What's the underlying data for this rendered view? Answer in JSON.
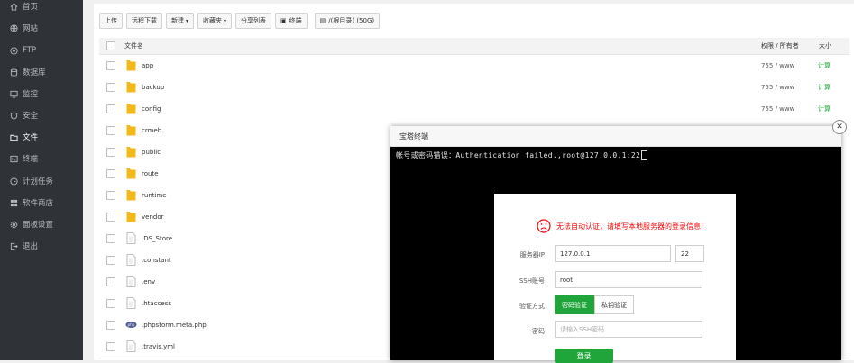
{
  "sidebar": {
    "items": [
      {
        "label": "首页",
        "icon": "home-icon"
      },
      {
        "label": "网站",
        "icon": "globe-icon"
      },
      {
        "label": "FTP",
        "icon": "ftp-icon"
      },
      {
        "label": "数据库",
        "icon": "database-icon"
      },
      {
        "label": "监控",
        "icon": "monitor-icon"
      },
      {
        "label": "安全",
        "icon": "shield-icon"
      },
      {
        "label": "文件",
        "icon": "folder-icon",
        "active": true
      },
      {
        "label": "终端",
        "icon": "terminal-icon"
      },
      {
        "label": "计划任务",
        "icon": "clock-icon"
      },
      {
        "label": "软件商店",
        "icon": "grid-icon"
      },
      {
        "label": "面板设置",
        "icon": "gear-icon"
      },
      {
        "label": "退出",
        "icon": "logout-icon"
      }
    ]
  },
  "toolbar": {
    "upload": "上传",
    "remote_download": "远程下载",
    "new": "新建",
    "favorites": "收藏夹",
    "share_list": "分享列表",
    "terminal": "终端",
    "path": "/(根目录) (50G)"
  },
  "table": {
    "headers": {
      "name": "文件名",
      "perm": "权限 / 所有者",
      "size": "大小"
    },
    "rows": [
      {
        "name": "app",
        "type": "folder",
        "perm": "755 / www",
        "size": "计算"
      },
      {
        "name": "backup",
        "type": "folder",
        "perm": "755 / www",
        "size": "计算"
      },
      {
        "name": "config",
        "type": "folder",
        "perm": "755 / www",
        "size": "计算"
      },
      {
        "name": "crmeb",
        "type": "folder",
        "perm": "",
        "size": ""
      },
      {
        "name": "public",
        "type": "folder",
        "perm": "",
        "size": ""
      },
      {
        "name": "route",
        "type": "folder",
        "perm": "",
        "size": ""
      },
      {
        "name": "runtime",
        "type": "folder",
        "perm": "",
        "size": ""
      },
      {
        "name": "vendor",
        "type": "folder",
        "perm": "",
        "size": ""
      },
      {
        "name": ".DS_Store",
        "type": "file",
        "perm": "",
        "size": ""
      },
      {
        "name": ".constant",
        "type": "file",
        "perm": "",
        "size": ""
      },
      {
        "name": ".env",
        "type": "file",
        "perm": "",
        "size": ""
      },
      {
        "name": ".htaccess",
        "type": "file",
        "perm": "",
        "size": ""
      },
      {
        "name": ".phpstorm.meta.php",
        "type": "php",
        "perm": "",
        "size": ""
      },
      {
        "name": ".travis.yml",
        "type": "file",
        "perm": "",
        "size": ""
      }
    ]
  },
  "terminal": {
    "title": "宝塔终端",
    "output": "帐号或密码错误：Authentication failed.,root@127.0.0.1:22"
  },
  "dialog": {
    "error": "无法自动认证，请填写本地服务器的登录信息!",
    "server_ip_label": "服务器IP",
    "server_ip": "127.0.0.1",
    "port": "22",
    "ssh_account_label": "SSH账号",
    "ssh_account": "root",
    "auth_method_label": "验证方式",
    "auth_password": "密码验证",
    "auth_key": "私钥验证",
    "password_label": "密码",
    "password_placeholder": "请输入SSH密码",
    "login": "登录"
  },
  "colors": {
    "sidebar_bg": "#2f3338",
    "accent_green": "#20a53a",
    "error_red": "#ef0808",
    "folder_yellow": "#f3b919"
  }
}
